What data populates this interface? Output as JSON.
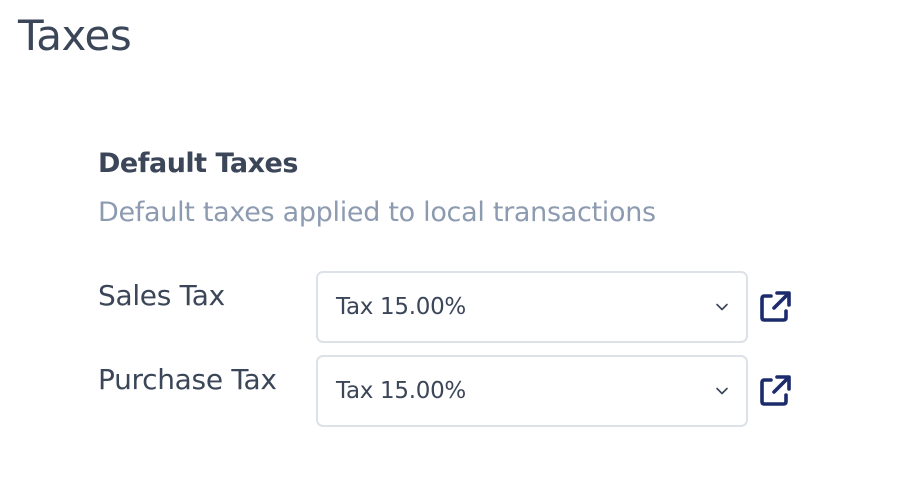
{
  "page": {
    "title": "Taxes"
  },
  "default_taxes": {
    "title": "Default Taxes",
    "description": "Default taxes applied to local transactions",
    "fields": [
      {
        "label": "Sales Tax",
        "selected_value": "Tax 15.00%"
      },
      {
        "label": "Purchase Tax",
        "selected_value": "Tax 15.00%"
      }
    ]
  },
  "icons": {
    "dropdown": "chevron-down-icon",
    "open": "external-link-icon"
  },
  "colors": {
    "text": "#3b4658",
    "muted_text": "#8d9bb0",
    "border": "#dde2e8",
    "link_icon": "#1c2b6b"
  }
}
